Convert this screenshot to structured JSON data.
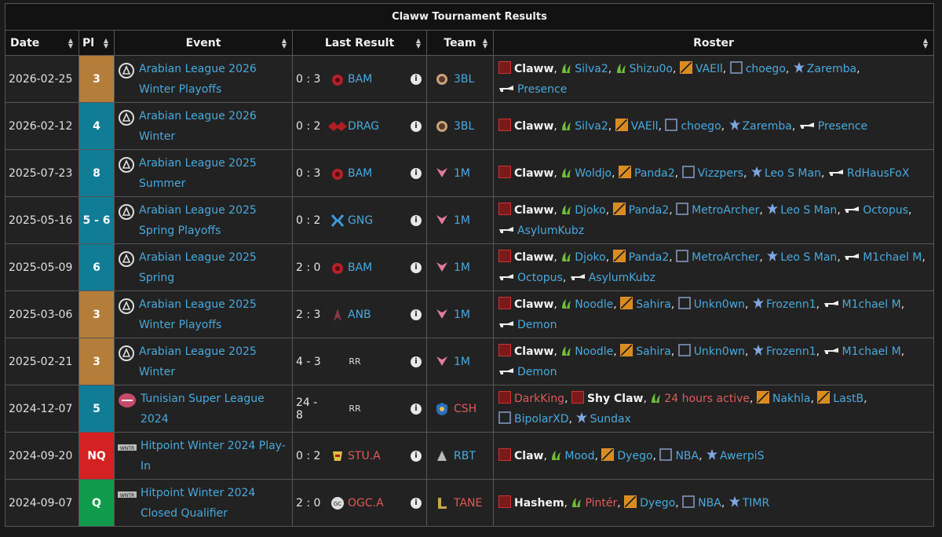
{
  "table_title": "Claww Tournament Results",
  "columns": [
    "Date",
    "Pl",
    "Event",
    "Last Result",
    "Team",
    "Roster"
  ],
  "colors": {
    "tan": "#b57d3a",
    "teal": "#117c96",
    "red": "#d42121",
    "green": "#0f9b4b",
    "link": "#49a9dd"
  },
  "rows": [
    {
      "date": "2026-02-25",
      "place": "3",
      "place_color": "tan",
      "event": "Arabian League 2026 Winter Playoffs",
      "event_icon": "arabian-league-icon",
      "score": "0 : 3",
      "opp_icon": "bam-icon",
      "opp": "BAM",
      "team_icon": "3bl-icon",
      "team": "3BL",
      "roster": [
        {
          "role": "top",
          "name": "Claww",
          "bold": true
        },
        {
          "role": "jungle",
          "name": "Silva2"
        },
        {
          "role": "jungle",
          "name": "Shizu0o"
        },
        {
          "role": "mid",
          "name": "VAEll"
        },
        {
          "role": "bot",
          "name": "choego"
        },
        {
          "role": "support",
          "name": "Zaremba"
        },
        {
          "role": "sub",
          "name": "Presence"
        }
      ]
    },
    {
      "date": "2026-02-12",
      "place": "4",
      "place_color": "teal",
      "event": "Arabian League 2026 Winter",
      "event_icon": "arabian-league-icon",
      "score": "0 : 2",
      "opp_icon": "drag-icon",
      "opp": "DRAG",
      "team_icon": "3bl-icon",
      "team": "3BL",
      "roster": [
        {
          "role": "top",
          "name": "Claww",
          "bold": true
        },
        {
          "role": "jungle",
          "name": "Silva2"
        },
        {
          "role": "mid",
          "name": "VAEll"
        },
        {
          "role": "bot",
          "name": "choego"
        },
        {
          "role": "support",
          "name": "Zaremba"
        },
        {
          "role": "sub",
          "name": "Presence"
        }
      ]
    },
    {
      "date": "2025-07-23",
      "place": "8",
      "place_color": "teal",
      "event": "Arabian League 2025 Summer",
      "event_icon": "arabian-league-icon",
      "score": "0 : 3",
      "opp_icon": "bam-icon",
      "opp": "BAM",
      "team_icon": "1m-icon",
      "team": "1M",
      "roster": [
        {
          "role": "top",
          "name": "Claww",
          "bold": true
        },
        {
          "role": "jungle",
          "name": "Woldjo"
        },
        {
          "role": "mid",
          "name": "Panda2"
        },
        {
          "role": "bot",
          "name": "Vizzpers"
        },
        {
          "role": "support",
          "name": "Leo S Man"
        },
        {
          "role": "sub",
          "name": "RdHausFoX"
        }
      ]
    },
    {
      "date": "2025-05-16",
      "place": "5 - 6",
      "place_color": "teal",
      "event": "Arabian League 2025 Spring Playoffs",
      "event_icon": "arabian-league-icon",
      "score": "0 : 2",
      "opp_icon": "gng-icon",
      "opp": "GNG",
      "team_icon": "1m-icon",
      "team": "1M",
      "roster": [
        {
          "role": "top",
          "name": "Claww",
          "bold": true
        },
        {
          "role": "jungle",
          "name": "Djoko"
        },
        {
          "role": "mid",
          "name": "Panda2"
        },
        {
          "role": "bot",
          "name": "MetroArcher"
        },
        {
          "role": "support",
          "name": "Leo S Man"
        },
        {
          "role": "sub",
          "name": "Octopus"
        },
        {
          "role": "sub",
          "name": "AsylumKubz"
        }
      ]
    },
    {
      "date": "2025-05-09",
      "place": "6",
      "place_color": "teal",
      "event": "Arabian League 2025 Spring",
      "event_icon": "arabian-league-icon",
      "score": "2 : 0",
      "opp_icon": "bam-icon",
      "opp": "BAM",
      "team_icon": "1m-icon",
      "team": "1M",
      "roster": [
        {
          "role": "top",
          "name": "Claww",
          "bold": true
        },
        {
          "role": "jungle",
          "name": "Djoko"
        },
        {
          "role": "mid",
          "name": "Panda2"
        },
        {
          "role": "bot",
          "name": "MetroArcher"
        },
        {
          "role": "support",
          "name": "Leo S Man"
        },
        {
          "role": "sub",
          "name": "M1chael M"
        },
        {
          "role": "sub",
          "name": "Octopus"
        },
        {
          "role": "sub",
          "name": "AsylumKubz"
        }
      ]
    },
    {
      "date": "2025-03-06",
      "place": "3",
      "place_color": "tan",
      "event": "Arabian League 2025 Winter Playoffs",
      "event_icon": "arabian-league-icon",
      "score": "2 : 3",
      "opp_icon": "anb-icon",
      "opp": "ANB",
      "team_icon": "1m-icon",
      "team": "1M",
      "roster": [
        {
          "role": "top",
          "name": "Claww",
          "bold": true
        },
        {
          "role": "jungle",
          "name": "Noodle"
        },
        {
          "role": "mid",
          "name": "Sahira"
        },
        {
          "role": "bot",
          "name": "Unkn0wn"
        },
        {
          "role": "support",
          "name": "Frozenn1"
        },
        {
          "role": "sub",
          "name": "M1chael M"
        },
        {
          "role": "sub",
          "name": "Demon"
        }
      ]
    },
    {
      "date": "2025-02-21",
      "place": "3",
      "place_color": "tan",
      "event": "Arabian League 2025 Winter",
      "event_icon": "arabian-league-icon",
      "score": "4 - 3",
      "rr": "RR",
      "team_icon": "1m-icon",
      "team": "1M",
      "roster": [
        {
          "role": "top",
          "name": "Claww",
          "bold": true
        },
        {
          "role": "jungle",
          "name": "Noodle"
        },
        {
          "role": "mid",
          "name": "Sahira"
        },
        {
          "role": "bot",
          "name": "Unkn0wn"
        },
        {
          "role": "support",
          "name": "Frozenn1"
        },
        {
          "role": "sub",
          "name": "M1chael M"
        },
        {
          "role": "sub",
          "name": "Demon"
        }
      ]
    },
    {
      "date": "2024-12-07",
      "place": "5",
      "place_color": "teal",
      "event": "Tunisian Super League 2024",
      "event_icon": "tunisian-league-icon",
      "score": "24 - 8",
      "rr": "RR",
      "team_icon": "csh-icon",
      "team": "CSH",
      "team_red": true,
      "roster": [
        {
          "role": "top",
          "name": "DarkKing",
          "red": true
        },
        {
          "role": "top",
          "name": "Shy Claw",
          "bold": true
        },
        {
          "role": "jungle",
          "name": "24 hours active",
          "red": true
        },
        {
          "role": "mid",
          "name": "Nakhla"
        },
        {
          "role": "mid",
          "name": "LastB"
        },
        {
          "role": "bot",
          "name": "BipolarXD"
        },
        {
          "role": "support",
          "name": "Sundax"
        }
      ]
    },
    {
      "date": "2024-09-20",
      "place": "NQ",
      "place_color": "red",
      "event": "Hitpoint Winter 2024 Play-In",
      "event_icon": "hitpoint-icon",
      "score": "0 : 2",
      "opp_icon": "stu-icon",
      "opp": "STU.A",
      "opp_red": true,
      "team_icon": "rbt-icon",
      "team": "RBT",
      "roster": [
        {
          "role": "top",
          "name": "Claw",
          "bold": true
        },
        {
          "role": "jungle",
          "name": "Mood"
        },
        {
          "role": "mid",
          "name": "Dyego"
        },
        {
          "role": "bot",
          "name": "NBA"
        },
        {
          "role": "support",
          "name": "AwerpiS"
        }
      ]
    },
    {
      "date": "2024-09-07",
      "place": "Q",
      "place_color": "green",
      "event": "Hitpoint Winter 2024 Closed Qualifier",
      "event_icon": "hitpoint-icon",
      "score": "2 : 0",
      "opp_icon": "ogc-icon",
      "opp": "OGC.A",
      "opp_red": true,
      "team_icon": "tane-icon",
      "team": "TANE",
      "team_red": true,
      "roster": [
        {
          "role": "top",
          "name": "Hashem",
          "bold": true
        },
        {
          "role": "jungle",
          "name": "Pintér",
          "red": true
        },
        {
          "role": "mid",
          "name": "Dyego"
        },
        {
          "role": "bot",
          "name": "NBA"
        },
        {
          "role": "support",
          "name": "TIMR"
        }
      ]
    }
  ]
}
